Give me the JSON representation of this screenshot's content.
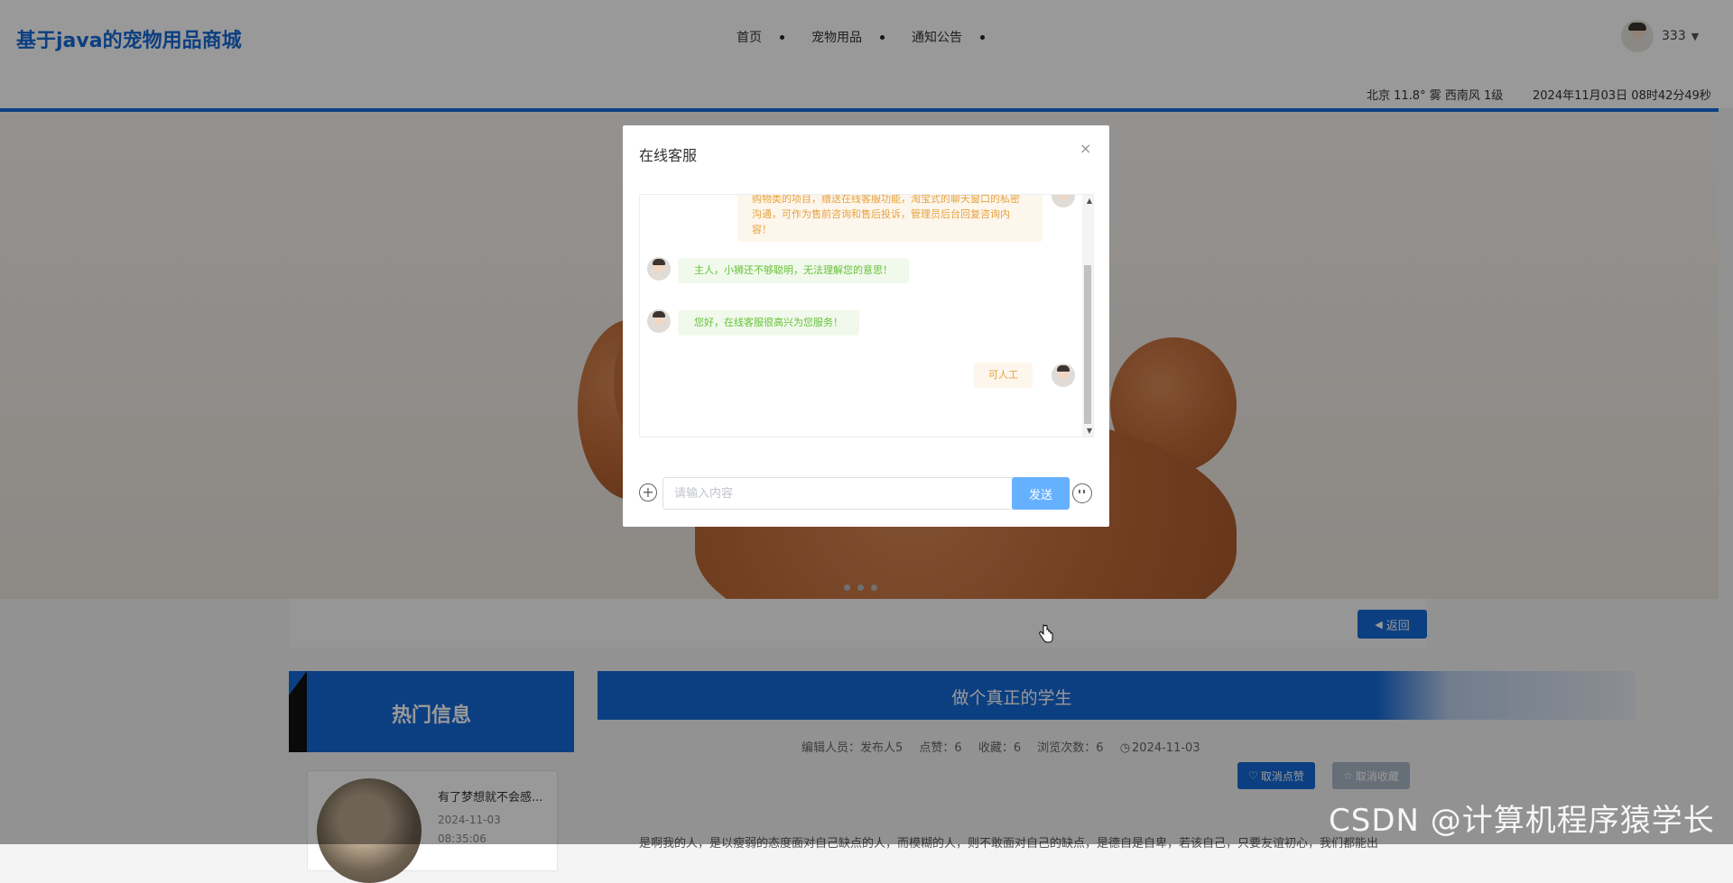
{
  "header": {
    "site_title": "基于java的宠物用品商城",
    "nav": [
      "首页",
      "宠物用品",
      "通知公告"
    ],
    "user": {
      "name": "333"
    }
  },
  "infobar": {
    "weather": "北京  11.8°  雾  西南风  1级",
    "datetime": "2024年11月03日 08时42分49秒"
  },
  "content": {
    "back_button": "返回",
    "sidebar_title": "热门信息",
    "hot_item": {
      "title": "有了梦想就不会感...",
      "date": "2024-11-03",
      "time": "08:35:06"
    },
    "article": {
      "title": "做个真正的学生",
      "meta": {
        "editor": "编辑人员：发布人5",
        "likes": "点赞：6",
        "favorites": "收藏：6",
        "views": "浏览次数：6",
        "date": "2024-11-03"
      },
      "like_button": "取消点赞",
      "fav_button": "取消收藏",
      "body_preview": "是啊我的人，是以瘦弱的态度面对自己缺点的人，而模糊的人，则不敢面对自己的缺点，是德自是自卑，若该自己，只要友谊初心，我们都能出"
    }
  },
  "chat": {
    "title": "在线客服",
    "messages": [
      {
        "from": "user",
        "text": "购物类的项目，赠送在线客服功能，淘宝式的聊天窗口的私密沟通，可作为售前咨询和售后投诉，管理员后台回复咨询内容！"
      },
      {
        "from": "service",
        "text": "主人，小狮还不够聪明，无法理解您的意思！"
      },
      {
        "from": "service",
        "text": "您好，在线客服很高兴为您服务！"
      },
      {
        "from": "user",
        "text": "可人工"
      }
    ],
    "input_placeholder": "请输入内容",
    "send_label": "发送"
  },
  "watermark": "CSDN @计算机程序猿学长",
  "colors": {
    "primary": "#1469d8",
    "send": "#66b1ff",
    "user_bubble": "#fdf6ec",
    "service_bubble": "#f0f9eb"
  }
}
